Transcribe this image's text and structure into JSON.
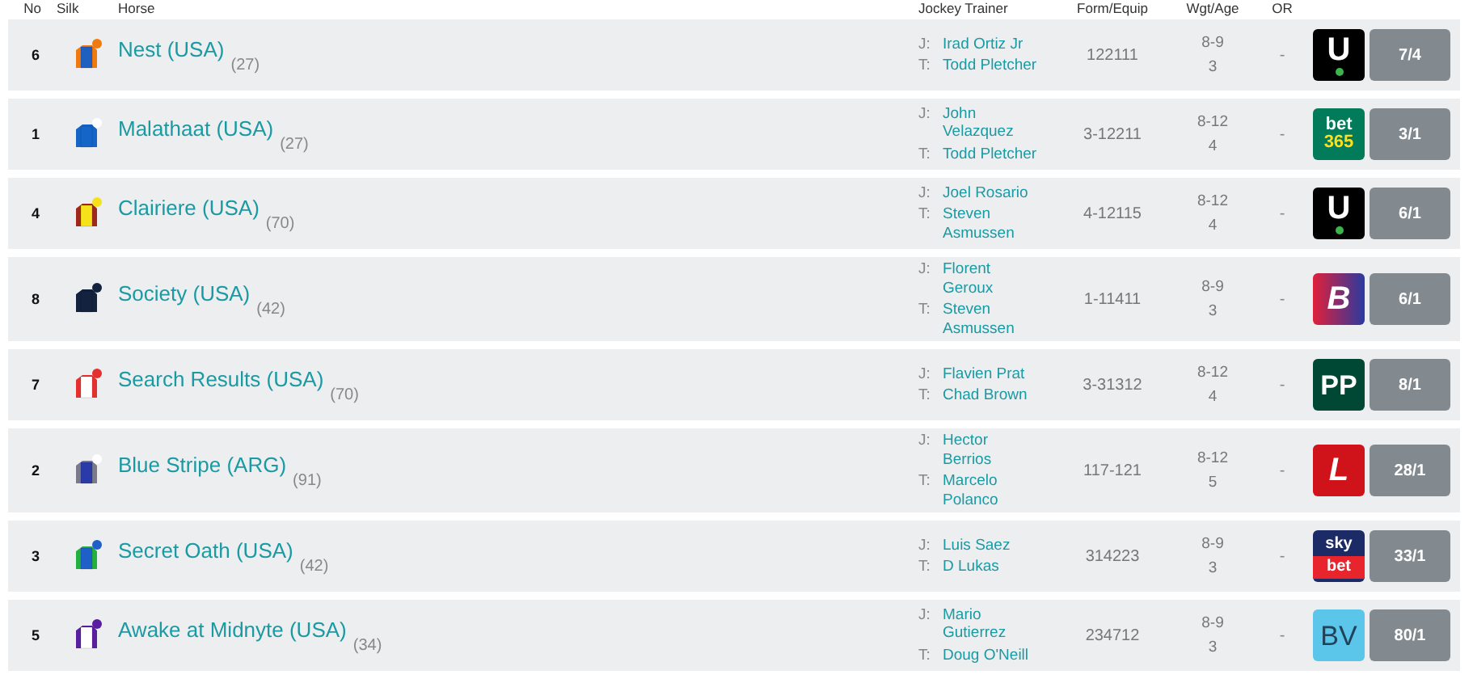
{
  "table": {
    "columns": [
      "No",
      "Silk",
      "Horse",
      "Jockey Trainer",
      "Form/Equip",
      "Wgt/Age",
      "OR"
    ],
    "rows": [
      {
        "no": "6",
        "silk": [
          {
            "kind": "sleeves",
            "color": "#f07a10"
          },
          {
            "kind": "body",
            "color": "#1f5fbf"
          },
          {
            "kind": "cap",
            "color": "#f07a10"
          }
        ],
        "horse": "Nest (USA)",
        "rating": "(27)",
        "jockey_label": "J:",
        "jockey": "Irad Ortiz Jr",
        "trainer_label": "T:",
        "trainer": "Todd Pletcher",
        "form": "122111",
        "weight": "8-9",
        "age": "3",
        "or": "-",
        "bookmaker": {
          "kind": "unibet",
          "lines": [
            "U"
          ]
        },
        "odds": "7/4"
      },
      {
        "no": "1",
        "silk": [
          {
            "kind": "sleeves",
            "color": "#1565c8"
          },
          {
            "kind": "body",
            "color": "#1565c8"
          },
          {
            "kind": "cap",
            "color": "#ffffff"
          }
        ],
        "horse": "Malathaat (USA)",
        "rating": "(27)",
        "jockey_label": "J:",
        "jockey": "John Velazquez",
        "trainer_label": "T:",
        "trainer": "Todd Pletcher",
        "form": "3-12211",
        "weight": "8-12",
        "age": "4",
        "or": "-",
        "bookmaker": {
          "kind": "bet365",
          "lines": [
            "bet",
            "365"
          ]
        },
        "odds": "3/1"
      },
      {
        "no": "4",
        "silk": [
          {
            "kind": "sleeves",
            "color": "#a0281a"
          },
          {
            "kind": "body",
            "color": "#f5e21a"
          },
          {
            "kind": "cap",
            "color": "#f5e21a"
          }
        ],
        "horse": "Clairiere (USA)",
        "rating": "(70)",
        "jockey_label": "J:",
        "jockey": "Joel Rosario",
        "trainer_label": "T:",
        "trainer": "Steven Asmussen",
        "form": "4-12115",
        "weight": "8-12",
        "age": "4",
        "or": "-",
        "bookmaker": {
          "kind": "unibet",
          "lines": [
            "U"
          ]
        },
        "odds": "6/1"
      },
      {
        "no": "8",
        "silk": [
          {
            "kind": "sleeves",
            "color": "#13233f"
          },
          {
            "kind": "body",
            "color": "#13233f"
          },
          {
            "kind": "cap",
            "color": "#13233f"
          }
        ],
        "horse": "Society (USA)",
        "rating": "(42)",
        "jockey_label": "J:",
        "jockey": "Florent Geroux",
        "trainer_label": "T:",
        "trainer": "Steven Asmussen",
        "form": "1-11411",
        "weight": "8-9",
        "age": "3",
        "or": "-",
        "bookmaker": {
          "kind": "boylesports",
          "lines": [
            "B"
          ]
        },
        "odds": "6/1"
      },
      {
        "no": "7",
        "silk": [
          {
            "kind": "sleeves",
            "color": "#e53030"
          },
          {
            "kind": "body",
            "color": "#ffffff"
          },
          {
            "kind": "cap",
            "color": "#e53030"
          }
        ],
        "horse": "Search Results (USA)",
        "rating": "(70)",
        "jockey_label": "J:",
        "jockey": "Flavien Prat",
        "trainer_label": "T:",
        "trainer": "Chad Brown",
        "form": "3-31312",
        "weight": "8-12",
        "age": "4",
        "or": "-",
        "bookmaker": {
          "kind": "paddypower",
          "lines": [
            "PP"
          ]
        },
        "odds": "8/1"
      },
      {
        "no": "2",
        "silk": [
          {
            "kind": "sleeves",
            "color": "#7a7a8a"
          },
          {
            "kind": "body",
            "color": "#2a3aa8"
          },
          {
            "kind": "cap",
            "color": "#ffffff"
          }
        ],
        "horse": "Blue Stripe (ARG)",
        "rating": "(91)",
        "jockey_label": "J:",
        "jockey": "Hector Berrios",
        "trainer_label": "T:",
        "trainer": "Marcelo Polanco",
        "form": "117-121",
        "weight": "8-12",
        "age": "5",
        "or": "-",
        "bookmaker": {
          "kind": "ladbrokes",
          "lines": [
            "L"
          ]
        },
        "odds": "28/1"
      },
      {
        "no": "3",
        "silk": [
          {
            "kind": "sleeves",
            "color": "#22b040"
          },
          {
            "kind": "body",
            "color": "#1e60c8"
          },
          {
            "kind": "cap",
            "color": "#1e60c8"
          }
        ],
        "horse": "Secret Oath (USA)",
        "rating": "(42)",
        "jockey_label": "J:",
        "jockey": "Luis Saez",
        "trainer_label": "T:",
        "trainer": "D Lukas",
        "form": "314223",
        "weight": "8-9",
        "age": "3",
        "or": "-",
        "bookmaker": {
          "kind": "skybet",
          "lines": [
            "sky",
            "bet"
          ]
        },
        "odds": "33/1"
      },
      {
        "no": "5",
        "silk": [
          {
            "kind": "sleeves",
            "color": "#5a1fa0"
          },
          {
            "kind": "body",
            "color": "#ffffff"
          },
          {
            "kind": "cap",
            "color": "#5a1fa0"
          }
        ],
        "horse": "Awake at Midnyte (USA)",
        "rating": "(34)",
        "jockey_label": "J:",
        "jockey": "Mario Gutierrez",
        "trainer_label": "T:",
        "trainer": "Doug O'Neill",
        "form": "234712",
        "weight": "8-9",
        "age": "3",
        "or": "-",
        "bookmaker": {
          "kind": "betvictor",
          "lines": [
            "BV"
          ]
        },
        "odds": "80/1"
      }
    ]
  }
}
